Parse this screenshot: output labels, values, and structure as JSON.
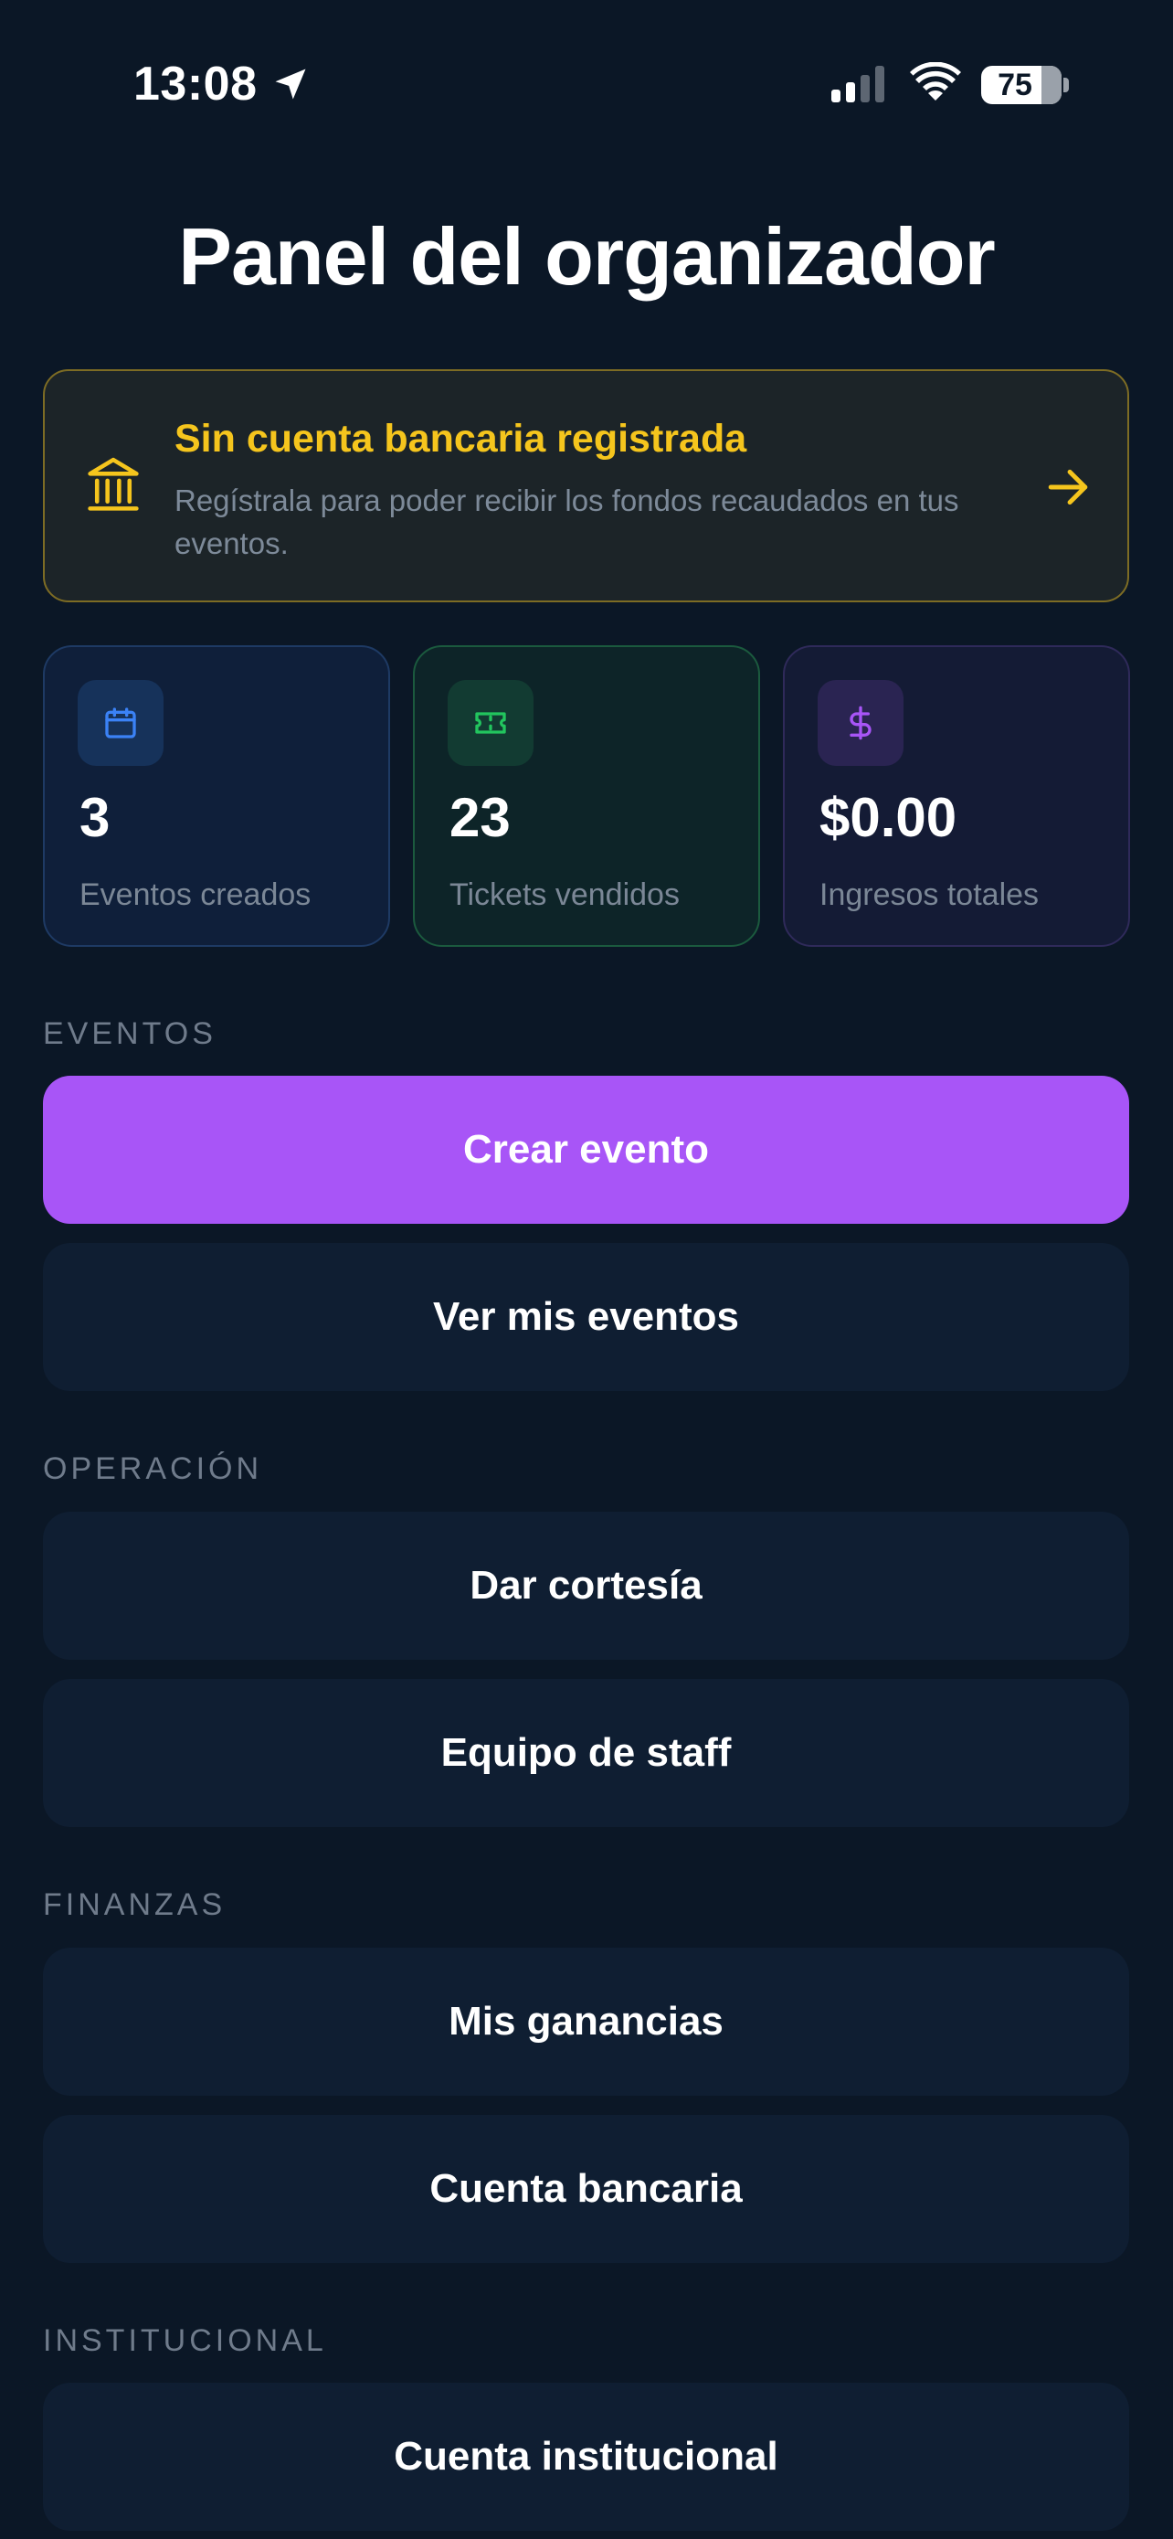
{
  "status_bar": {
    "time": "13:08",
    "battery_percent": "75",
    "battery_level": 75
  },
  "page": {
    "title": "Panel del organizador"
  },
  "banner": {
    "title": "Sin cuenta bancaria registrada",
    "description": "Regístrala para poder recibir los fondos recaudados en tus eventos.",
    "icon": "bank-icon",
    "accent_color": "#f5c51d"
  },
  "stats": [
    {
      "value": "3",
      "label": "Eventos creados",
      "icon": "calendar-icon",
      "color": "#3b82f6"
    },
    {
      "value": "23",
      "label": "Tickets vendidos",
      "icon": "ticket-icon",
      "color": "#22c55e"
    },
    {
      "value": "$0.00",
      "label": "Ingresos totales",
      "icon": "dollar-icon",
      "color": "#a855f7"
    }
  ],
  "sections": {
    "eventos": {
      "label": "EVENTOS",
      "create_event": "Crear evento",
      "my_events": "Ver mis eventos"
    },
    "operacion": {
      "label": "OPERACIÓN",
      "courtesy": "Dar cortesía",
      "staff": "Equipo de staff"
    },
    "finanzas": {
      "label": "FINANZAS",
      "earnings": "Mis ganancias",
      "bank_account": "Cuenta bancaria"
    },
    "institucional": {
      "label": "INSTITUCIONAL",
      "institutional_account": "Cuenta institucional"
    }
  },
  "colors": {
    "background": "#0b1726",
    "primary_button": "#a855f7",
    "secondary_button": "#0f1e32"
  }
}
